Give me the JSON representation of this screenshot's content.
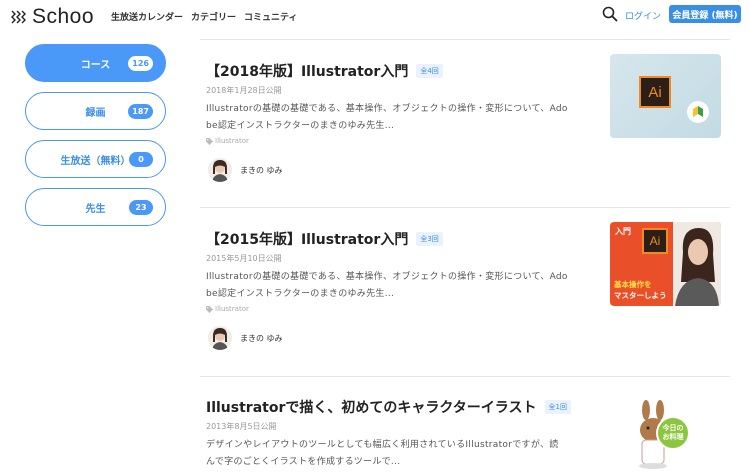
{
  "header": {
    "logo_text": "Schoo",
    "nav": [
      "生放送カレンダー",
      "カテゴリー",
      "コミュニティ"
    ],
    "login": "ログイン",
    "signup": "会員登録 (無料)"
  },
  "sidebar": {
    "items": [
      {
        "label": "コース",
        "count": "126",
        "active": true
      },
      {
        "label": "録画",
        "count": "187",
        "active": false
      },
      {
        "label": "生放送（無料）",
        "count": "0",
        "active": false
      },
      {
        "label": "先生",
        "count": "23",
        "active": false
      }
    ]
  },
  "courses": [
    {
      "title": "【2018年版】Illustrator入門",
      "count": "全4回",
      "date": "2018年1月28日公開",
      "desc1": "Illustratorの基礎の基礎である、基本操作、オブジェクトの操作・変形について、Ado",
      "desc2": "be認定インストラクターのまきのゆみ先生...",
      "tag": "Illustrator",
      "author": "まきの ゆみ",
      "thumb_text": "Ai"
    },
    {
      "title": "【2015年版】Illustrator入門",
      "count": "全3回",
      "date": "2015年5月10日公開",
      "desc1": "Illustratorの基礎の基礎である、基本操作、オブジェクトの操作・変形について、Ado",
      "desc2": "be認定インストラクターのまきのゆみ先生...",
      "tag": "Illustrator",
      "author": "まきの ゆみ",
      "thumb_label": "入門",
      "thumb_ai": "Ai",
      "thumb_caption1": "基本操作を",
      "thumb_caption2": "マスターしよう"
    },
    {
      "title": "Illustratorで描く、初めてのキャラクターイラスト",
      "count": "全1回",
      "date": "2013年8月5日公開",
      "desc1": "デザインやレイアウトのツールとしても幅広く利用されているIllustratorですが、読",
      "desc2": "んで字のごとくイラストを作成するツールで...",
      "thumb_text1": "今日の",
      "thumb_text2": "お料理"
    }
  ]
}
